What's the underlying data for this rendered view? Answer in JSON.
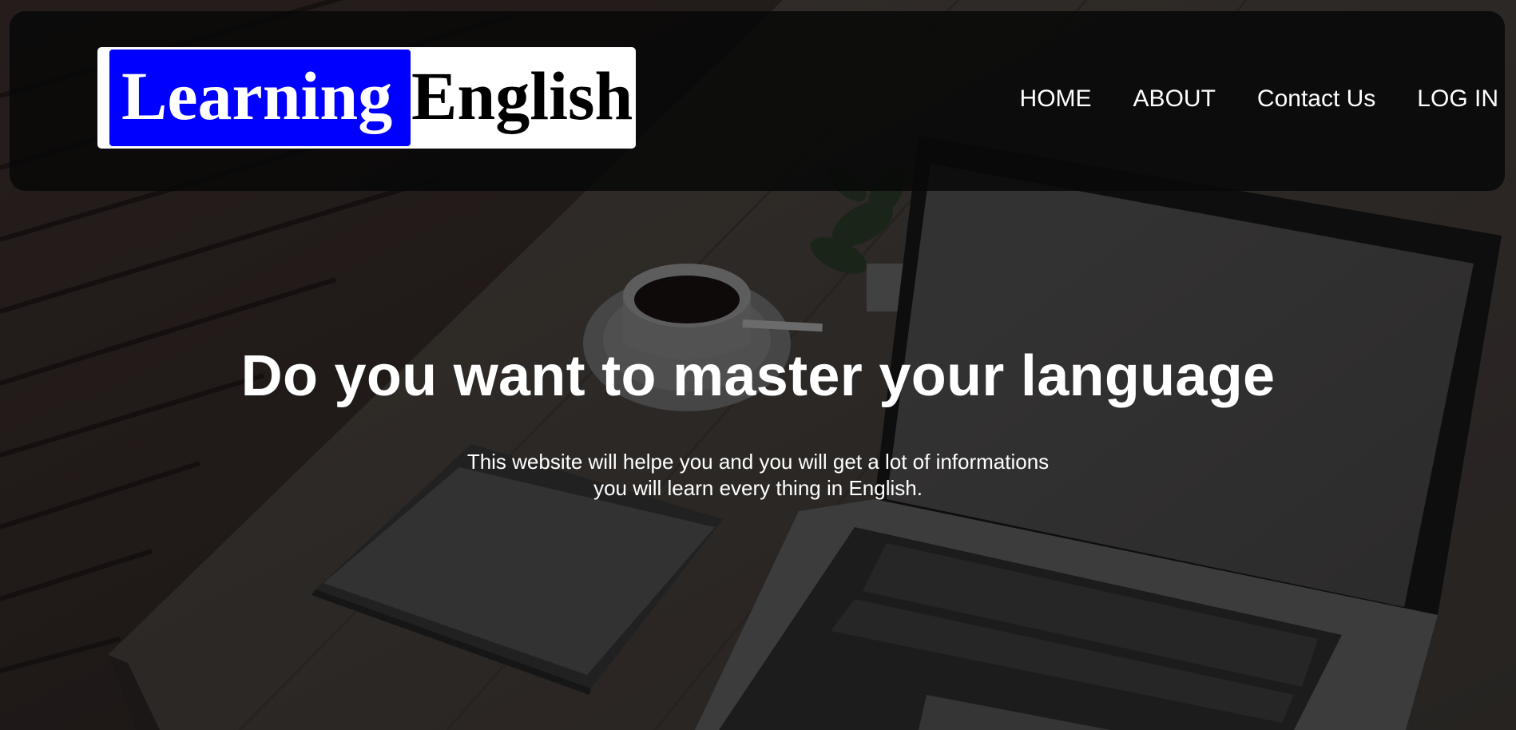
{
  "logo": {
    "word1": "Learning",
    "word2": "English",
    "accent_color": "#0000ff"
  },
  "nav": {
    "items": [
      {
        "label": "HOME"
      },
      {
        "label": "ABOUT"
      },
      {
        "label": "Contact Us"
      },
      {
        "label": "LOG IN"
      }
    ]
  },
  "hero": {
    "title": "Do you want to master your language",
    "subtitle_line1": "This website will helpe you and you will get a lot of informations",
    "subtitle_line2": "you will learn every thing in English."
  },
  "background": {
    "description_icons": [
      "laptop-image",
      "coffee-cup-image",
      "graphics-tablet-image",
      "plant-image",
      "wooden-desk-image"
    ]
  }
}
